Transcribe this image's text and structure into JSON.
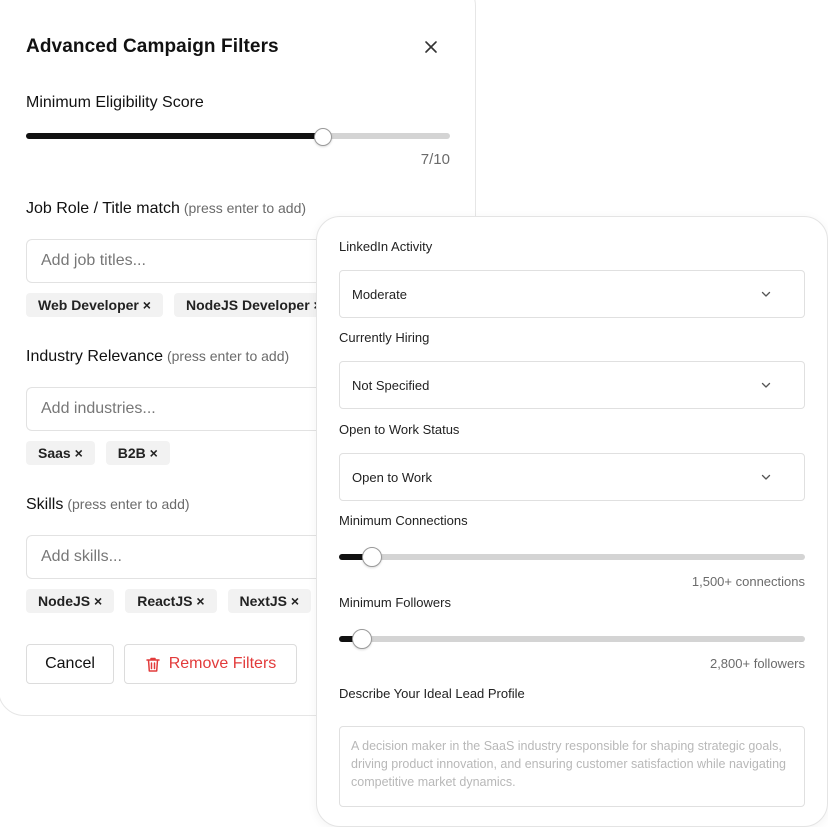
{
  "dialog": {
    "title": "Advanced Campaign Filters"
  },
  "eligibility": {
    "label": "Minimum Eligibility Score",
    "value_text": "7/10",
    "value": 0.7
  },
  "job_role": {
    "label": "Job Role / Title match",
    "hint": "(press enter to add)",
    "placeholder": "Add job titles...",
    "tags": [
      "Web Developer ×",
      "NodeJS Developer ×"
    ]
  },
  "industry": {
    "label": "Industry Relevance",
    "hint": "(press enter to add)",
    "placeholder": "Add industries...",
    "tags": [
      "Saas ×",
      "B2B ×"
    ]
  },
  "skills": {
    "label": "Skills",
    "hint": "(press enter to add)",
    "placeholder": "Add skills...",
    "tags": [
      "NodeJS ×",
      "ReactJS ×",
      "NextJS ×"
    ]
  },
  "actions": {
    "cancel": "Cancel",
    "remove": "Remove Filters"
  },
  "linkedin_activity": {
    "label": "LinkedIn Activity",
    "value": "Moderate"
  },
  "currently_hiring": {
    "label": "Currently Hiring",
    "value": "Not Specified"
  },
  "open_to_work": {
    "label": "Open to Work Status",
    "value": "Open to Work"
  },
  "min_connections": {
    "label": "Minimum Connections",
    "value_text": "1,500+ connections",
    "value": 0.07
  },
  "min_followers": {
    "label": "Minimum Followers",
    "value_text": "2,800+ followers",
    "value": 0.05
  },
  "lead_profile": {
    "label": "Describe Your Ideal Lead Profile",
    "placeholder": "A decision maker in the SaaS industry responsible for shaping strategic goals, driving product innovation, and ensuring customer satisfaction while navigating competitive market dynamics."
  },
  "colors": {
    "accent": "#111111",
    "danger": "#e23b3b",
    "track": "#d4d4d4"
  },
  "icons": {
    "close": "close-icon",
    "trash": "trash-icon",
    "chevron": "chevron-down-icon"
  }
}
